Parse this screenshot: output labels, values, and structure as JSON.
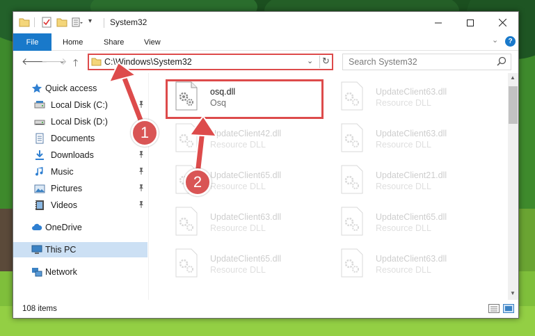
{
  "window": {
    "title": "System32"
  },
  "ribbon": {
    "file_tab": "File",
    "tabs": [
      "Home",
      "Share",
      "View"
    ]
  },
  "navigation": {
    "address_path": "C:\\Windows\\System32",
    "search_placeholder": "Search System32"
  },
  "sidebar": {
    "items": [
      {
        "label": "Quick access",
        "icon": "star-icon"
      },
      {
        "label": "Local Disk (C:)",
        "icon": "drive-icon",
        "pinned": true
      },
      {
        "label": "Local Disk (D:)",
        "icon": "drive-icon"
      },
      {
        "label": "Documents",
        "icon": "documents-icon",
        "pinned": true
      },
      {
        "label": "Downloads",
        "icon": "download-icon",
        "pinned": true
      },
      {
        "label": "Music",
        "icon": "music-icon",
        "pinned": true
      },
      {
        "label": "Pictures",
        "icon": "pictures-icon",
        "pinned": true
      },
      {
        "label": "Videos",
        "icon": "videos-icon",
        "pinned": true
      },
      {
        "label": "OneDrive",
        "icon": "cloud-icon"
      },
      {
        "label": "This PC",
        "icon": "computer-icon",
        "selected": true
      },
      {
        "label": "Network",
        "icon": "network-icon"
      }
    ]
  },
  "files": {
    "column1": [
      {
        "name": "osq.dll",
        "type": "Osq",
        "highlighted": true
      },
      {
        "name": "UpdateClient42.dll",
        "type": "Resource DLL"
      },
      {
        "name": "UpdateClient65.dll",
        "type": "Resource DLL"
      },
      {
        "name": "UpdateClient63.dll",
        "type": "Resource DLL"
      },
      {
        "name": "UpdateClient65.dll",
        "type": "Resource DLL"
      }
    ],
    "column2": [
      {
        "name": "UpdateClient63.dll",
        "type": "Resource DLL"
      },
      {
        "name": "UpdateClient63.dll",
        "type": "Resource DLL"
      },
      {
        "name": "UpdateClient21.dll",
        "type": "Resource DLL"
      },
      {
        "name": "UpdateClient65.dll",
        "type": "Resource DLL"
      },
      {
        "name": "UpdateClient63.dll",
        "type": "Resource DLL"
      }
    ]
  },
  "status": {
    "item_count": "108 items"
  },
  "annotations": {
    "step1": "1",
    "step2": "2",
    "color": "#dd4b4b"
  }
}
